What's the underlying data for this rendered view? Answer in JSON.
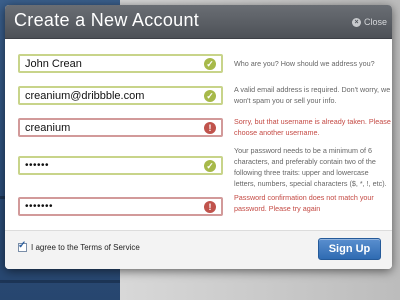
{
  "modal": {
    "title": "Create a New Account",
    "close_label": "Close"
  },
  "form": {
    "fields": [
      {
        "name": "fullname",
        "value": "John Crean",
        "status": "ok",
        "hint": "Who are you? How should we address you?",
        "hint_status": "normal"
      },
      {
        "name": "email",
        "value": "creanium@dribbble.com",
        "status": "ok",
        "hint": "A valid email address is required. Don't worry, we won't spam you or sell your info.",
        "hint_status": "normal"
      },
      {
        "name": "username",
        "value": "creanium",
        "status": "error",
        "hint": "Sorry, but that username is already taken. Please choose another username.",
        "hint_status": "error"
      },
      {
        "name": "password",
        "value": "••••••",
        "status": "ok",
        "hint": "Your password needs to be a minimum of 6 characters, and preferably contain two of the following three traits: upper and lowercase letters, numbers, special characters ($, *, !, etc).",
        "hint_status": "normal"
      },
      {
        "name": "password-confirm",
        "value": "•••••••",
        "status": "error",
        "hint": "Password confirmation does not match your password. Please try again",
        "hint_status": "error"
      }
    ]
  },
  "footer": {
    "terms_label": "I agree to the Terms of Service",
    "terms_checked": true,
    "signup_label": "Sign Up"
  },
  "colors": {
    "accent": "#2f6bb2",
    "ok": "#a7b94a",
    "error": "#c0534c",
    "header": "#4d5157"
  }
}
